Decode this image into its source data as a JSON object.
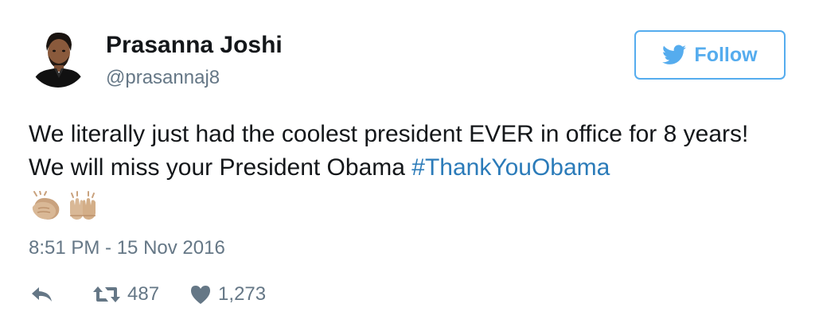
{
  "tweet": {
    "author": {
      "name": "Prasanna Joshi",
      "handle": "@prasannaj8"
    },
    "follow_button": {
      "label": "Follow",
      "icon": "twitter-bird-icon"
    },
    "text": {
      "body": "We literally just had the coolest president EVER in office for 8 years! We will miss your President Obama ",
      "hashtag": "#ThankYouObama"
    },
    "emojis": [
      {
        "name": "clapping-hands-emoji"
      },
      {
        "name": "raising-hands-emoji"
      }
    ],
    "timestamp": "8:51 PM - 15 Nov 2016",
    "actions": {
      "reply_icon": "reply-icon",
      "retweet_icon": "retweet-icon",
      "retweet_count": "487",
      "like_icon": "heart-icon",
      "like_count": "1,273"
    },
    "colors": {
      "brand_blue": "#55acee",
      "hashtag_blue": "#2b7bb9",
      "text": "#14171a",
      "muted": "#657786"
    }
  }
}
